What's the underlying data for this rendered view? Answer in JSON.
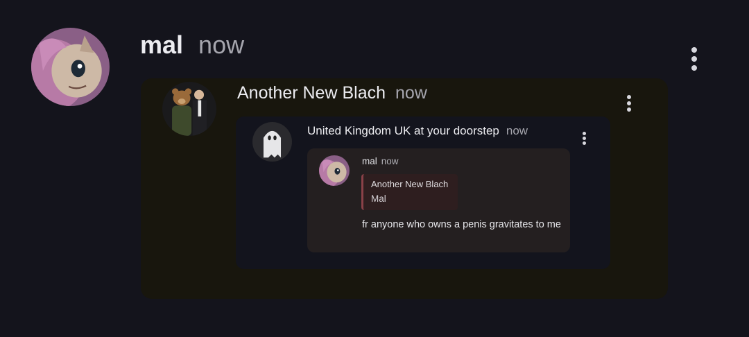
{
  "post": {
    "author": "mal",
    "time": "now",
    "avatar_icon": "pony-avatar",
    "menu_icon": "kebab-menu-icon",
    "repost": {
      "author": "Another New Blach",
      "time": "now",
      "avatar_icon": "bear-and-man-avatar",
      "menu_icon": "kebab-menu-icon",
      "repost": {
        "author": "United Kingdom UK at your doorstep",
        "time": "now",
        "avatar_icon": "ghost-avatar",
        "menu_icon": "kebab-menu-icon",
        "reply": {
          "author": "mal",
          "time": "now",
          "avatar_icon": "pony-avatar",
          "quote": {
            "author": "Another New Blach",
            "text": "Mal"
          },
          "message": "fr anyone who owns a penis gravitates to me"
        }
      }
    }
  },
  "colors": {
    "background": "#14141c",
    "card_level2": "#18160d",
    "card_level3": "#13141d",
    "card_level4": "#241f20",
    "quote_bar": "#8a4148"
  }
}
